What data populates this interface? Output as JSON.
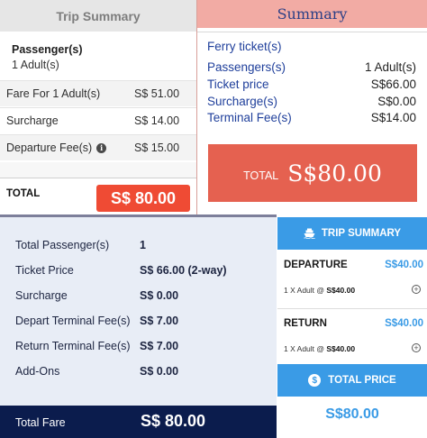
{
  "panel_a": {
    "header": "Trip Summary",
    "passenger_label": "Passenger(s)",
    "passenger_value": "1 Adult(s)",
    "rows": [
      {
        "label": "Fare For 1 Adult(s)",
        "value": "S$ 51.00"
      },
      {
        "label": "Surcharge",
        "value": "S$ 14.00"
      },
      {
        "label": "Departure Fee(s)",
        "value": "S$ 15.00"
      }
    ],
    "total_label": "TOTAL",
    "total_value": "S$ 80.00",
    "accent": "#ef4b34"
  },
  "panel_b": {
    "header": "Summary",
    "section_title": "Ferry ticket(s)",
    "rows": [
      {
        "label": "Passengers(s)",
        "value": "1 Adult(s)"
      },
      {
        "label": "Ticket price",
        "value": "S$66.00"
      },
      {
        "label": "Surcharge(s)",
        "value": "S$0.00"
      },
      {
        "label": "Terminal Fee(s)",
        "value": "S$14.00"
      }
    ],
    "total_label": "TOTAL",
    "total_value": "S$80.00",
    "accent": "#e56150"
  },
  "panel_c": {
    "rows": [
      {
        "label": "Total Passenger(s)",
        "value": "1"
      },
      {
        "label": "Ticket Price",
        "value": "S$ 66.00 (2-way)"
      },
      {
        "label": "Surcharge",
        "value": "S$ 0.00"
      },
      {
        "label": "Depart Terminal Fee(s)",
        "value": "S$ 7.00"
      },
      {
        "label": "Return Terminal Fee(s)",
        "value": "S$ 7.00"
      },
      {
        "label": "Add-Ons",
        "value": "S$ 0.00"
      }
    ],
    "total_label": "Total Fare",
    "total_value": "S$ 80.00",
    "accent": "#0b1c4d"
  },
  "panel_d": {
    "header": "TRIP SUMMARY",
    "departure": {
      "title": "DEPARTURE",
      "price": "S$40.00",
      "detail_prefix": "1 X Adult @ ",
      "detail_price": "S$40.00"
    },
    "return": {
      "title": "RETURN",
      "price": "S$40.00",
      "detail_prefix": "1 X Adult @ ",
      "detail_price": "S$40.00"
    },
    "total_label": "TOTAL PRICE",
    "total_icon_glyph": "$",
    "total_value": "S$80.00",
    "accent": "#3a9be6",
    "icons": [
      "ship-icon",
      "dollar-coin-icon",
      "plus-circle-icon"
    ]
  }
}
